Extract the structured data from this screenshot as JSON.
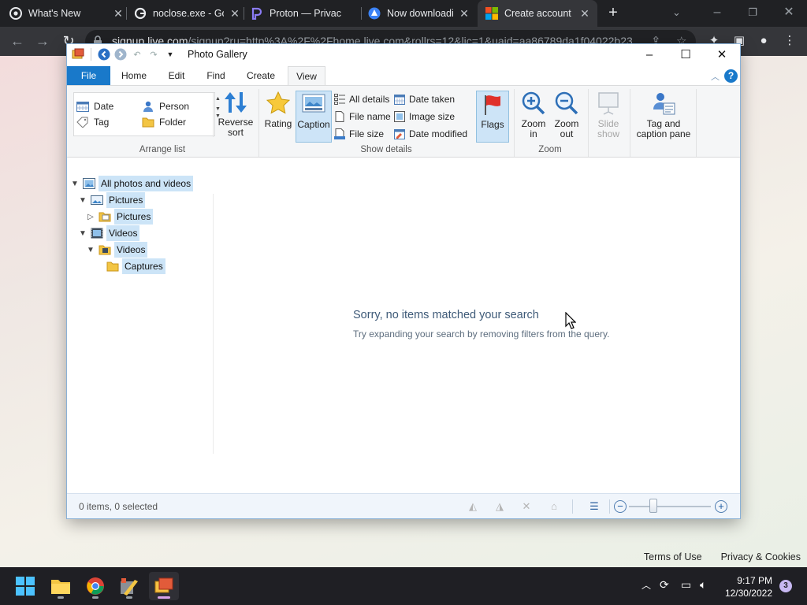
{
  "browser": {
    "tabs": [
      {
        "title": "What's New"
      },
      {
        "title": "noclose.exe - Go"
      },
      {
        "title": "Proton — Privac"
      },
      {
        "title": "Now downloadi"
      },
      {
        "title": "Create account"
      }
    ],
    "url": "signup.live.com",
    "url_rest": "/signup?ru=http%3A%2F%2Fhome.live.com&rollrs=12&lic=1&uaid=aa86789da1f04022b23",
    "footer": {
      "terms": "Terms of Use",
      "privacy": "Privacy & Cookies"
    }
  },
  "gallery": {
    "title": "Photo Gallery",
    "ribbon_tabs": [
      "File",
      "Home",
      "Edit",
      "Find",
      "Create",
      "View"
    ],
    "arrange": {
      "items": [
        "Date",
        "Person",
        "Tag",
        "Folder"
      ],
      "reverse_sort": "Reverse sort",
      "group_label": "Arrange list"
    },
    "show_details": {
      "rating": "Rating",
      "caption": "Caption",
      "all_details": "All details",
      "file_name": "File name",
      "file_size": "File size",
      "date_taken": "Date taken",
      "image_size": "Image size",
      "date_modified": "Date modified",
      "flags": "Flags",
      "group_label": "Show details"
    },
    "zoom": {
      "zoom_in": "Zoom in",
      "zoom_out": "Zoom out",
      "slide_show": "Slide show",
      "tag_caption_pane": "Tag and caption pane",
      "group_label": "Zoom"
    },
    "tree": [
      {
        "label": "All photos and videos"
      },
      {
        "label": "Pictures"
      },
      {
        "label": "Pictures"
      },
      {
        "label": "Videos"
      },
      {
        "label": "Videos"
      },
      {
        "label": "Captures"
      }
    ],
    "empty_title": "Sorry, no items matched your search",
    "empty_hint": "Try expanding your search by removing filters from the query.",
    "status": "0 items, 0 selected",
    "zoom_level": 0.3
  },
  "taskbar": {
    "time": "9:17 PM",
    "date": "12/30/2022",
    "notifications": "3"
  },
  "colors": {
    "accent": "#1979ca",
    "selection": "#cce4f7"
  }
}
